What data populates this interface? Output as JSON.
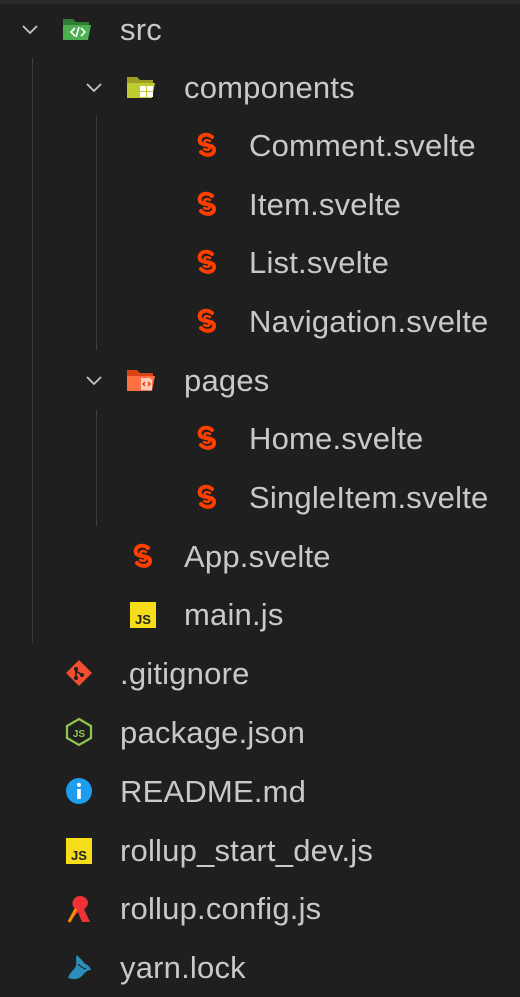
{
  "explorer": {
    "src": {
      "label": "src"
    },
    "components": {
      "label": "components"
    },
    "comment": {
      "label": "Comment.svelte"
    },
    "item": {
      "label": "Item.svelte"
    },
    "list": {
      "label": "List.svelte"
    },
    "navigation": {
      "label": "Navigation.svelte"
    },
    "pages": {
      "label": "pages"
    },
    "home": {
      "label": "Home.svelte"
    },
    "singleitem": {
      "label": "SingleItem.svelte"
    },
    "app": {
      "label": "App.svelte"
    },
    "main": {
      "label": "main.js"
    },
    "gitignore": {
      "label": ".gitignore"
    },
    "package": {
      "label": "package.json"
    },
    "readme": {
      "label": "README.md"
    },
    "rollup_start": {
      "label": "rollup_start_dev.js"
    },
    "rollup_config": {
      "label": "rollup.config.js"
    },
    "yarn": {
      "label": "yarn.lock"
    }
  },
  "icons": {
    "folder_src": "folder-src-open-icon",
    "folder_components": "folder-components-open-icon",
    "folder_pages": "folder-pages-open-icon",
    "svelte": "svelte-icon",
    "js": "javascript-icon",
    "git": "git-icon",
    "node": "nodejs-icon",
    "info": "info-icon",
    "rollup": "rollup-icon",
    "yarn": "yarn-icon",
    "chevron": "chevron-down-icon"
  },
  "colors": {
    "background": "#1f1f1f",
    "text": "#c9c9c9",
    "svelte": "#ff3e00",
    "js_badge": "#f5de19",
    "git": "#f14e32",
    "node": "#8cc84b",
    "info": "#1e9cf0",
    "rollup": "#ef3335",
    "yarn": "#2c8ebb",
    "folder_src": "#4caf50",
    "folder_components": "#c0ca33",
    "folder_pages": "#ff7043"
  }
}
